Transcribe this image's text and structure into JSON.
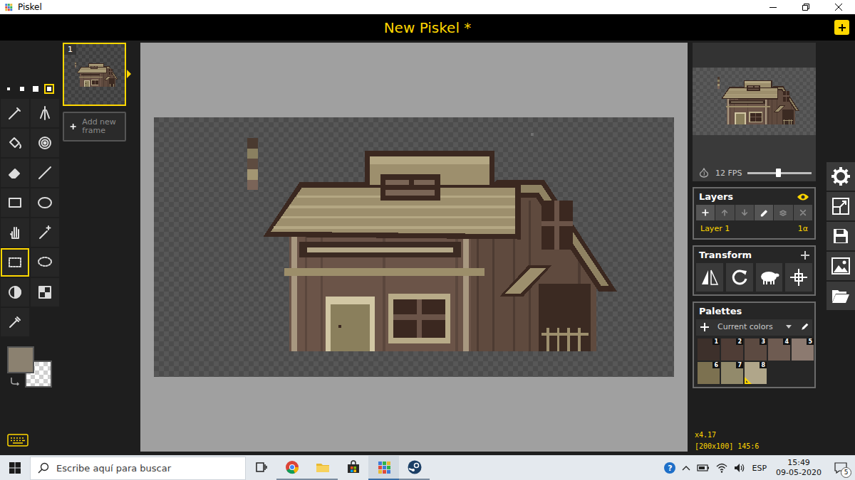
{
  "window": {
    "title": "Piskel"
  },
  "header": {
    "title": "New Piskel *"
  },
  "pen_sizes": [
    {
      "selected": false
    },
    {
      "selected": false
    },
    {
      "selected": false
    },
    {
      "selected": true
    }
  ],
  "tools": [
    {
      "kind": "pen",
      "selected": false
    },
    {
      "kind": "mirror",
      "selected": false
    },
    {
      "kind": "bucket",
      "selected": false
    },
    {
      "kind": "paint-same",
      "selected": false
    },
    {
      "kind": "eraser",
      "selected": false
    },
    {
      "kind": "stroke",
      "selected": false
    },
    {
      "kind": "rectangle",
      "selected": false
    },
    {
      "kind": "circle",
      "selected": false
    },
    {
      "kind": "move",
      "selected": false
    },
    {
      "kind": "shape-select",
      "selected": false
    },
    {
      "kind": "rect-select",
      "selected": true
    },
    {
      "kind": "lasso-select",
      "selected": false
    },
    {
      "kind": "lighten",
      "selected": false
    },
    {
      "kind": "dither",
      "selected": false
    },
    {
      "kind": "color-picker",
      "selected": false
    }
  ],
  "primary_color": "#8b8170",
  "secondary_transparent": true,
  "frames": [
    {
      "number": "1",
      "selected": true
    }
  ],
  "add_frame": {
    "label": "Add new frame"
  },
  "preview": {
    "fps": "12 FPS",
    "level": 0.48
  },
  "layers": {
    "title": "Layers",
    "buttons": [
      {
        "kind": "add",
        "disabled": false
      },
      {
        "kind": "up",
        "disabled": true
      },
      {
        "kind": "down",
        "disabled": true
      },
      {
        "kind": "edit",
        "disabled": false
      },
      {
        "kind": "merge",
        "disabled": true
      },
      {
        "kind": "delete",
        "disabled": true
      }
    ],
    "items": [
      {
        "name": "Layer 1",
        "opacity": "1α",
        "selected": true
      }
    ]
  },
  "transform": {
    "title": "Transform"
  },
  "palettes": {
    "title": "Palettes",
    "current": "Current colors",
    "swatches": [
      {
        "number": "1",
        "color": "#3d302b",
        "selected": false
      },
      {
        "number": "2",
        "color": "#4f3d36",
        "selected": false
      },
      {
        "number": "3",
        "color": "#5c4a41",
        "selected": false
      },
      {
        "number": "4",
        "color": "#6e5b51",
        "selected": false
      },
      {
        "number": "5",
        "color": "#8c7a70",
        "selected": false
      },
      {
        "number": "6",
        "color": "#7c7150",
        "selected": false
      },
      {
        "number": "7",
        "color": "#928a6b",
        "selected": false
      },
      {
        "number": "8",
        "color": "#b0a68a",
        "selected": true
      }
    ]
  },
  "status": {
    "zoom": "x4.17",
    "info": "[200x100] 145:6"
  },
  "taskbar": {
    "search_placeholder": "Escribe aquí para buscar",
    "apps": [
      {
        "kind": "task-view",
        "running": false,
        "selected": false
      },
      {
        "kind": "chrome",
        "running": true,
        "selected": false
      },
      {
        "kind": "explorer",
        "running": true,
        "selected": false
      },
      {
        "kind": "store",
        "running": false,
        "selected": false
      },
      {
        "kind": "piskel",
        "running": true,
        "selected": true
      },
      {
        "kind": "steam",
        "running": true,
        "selected": false
      }
    ],
    "help": "?",
    "language": "ESP",
    "time": "15:49",
    "date": "09-05-2020",
    "notifications": "5"
  }
}
